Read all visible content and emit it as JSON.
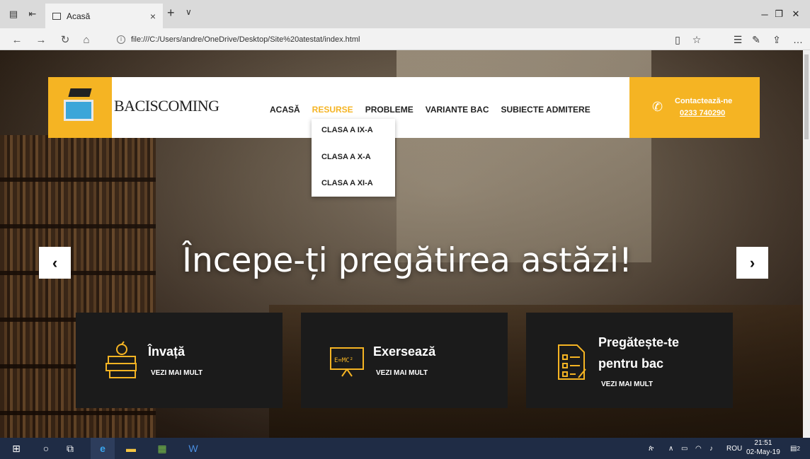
{
  "browser": {
    "tab_title": "Acasă",
    "tab_close": "×",
    "new_tab": "+",
    "tab_menu": "∨",
    "url": "file:///C:/Users/andre/OneDrive/Desktop/Site%20atestat/index.html",
    "minimize": "─",
    "restore": "❐",
    "close": "✕"
  },
  "header": {
    "brand": "BACISCOMING",
    "menu": [
      "ACASĂ",
      "RESURSE",
      "PROBLEME",
      "VARIANTE BAC",
      "SUBIECTE ADMITERE"
    ],
    "active_menu": "RESURSE",
    "contact_label": "Contactează-ne",
    "contact_phone": "0233 740290"
  },
  "dropdown": [
    "CLASA A IX-A",
    "CLASA A X-A",
    "CLASA A XI-A"
  ],
  "hero": {
    "title": "Începe-ți pregătirea astăzi!",
    "prev": "‹",
    "next": "›"
  },
  "features": [
    {
      "title": "Învață",
      "link": "VEZI MAI MULT",
      "icon": "books-apple-icon"
    },
    {
      "title": "Exersează",
      "link": "VEZI MAI MULT",
      "icon": "blackboard-icon"
    },
    {
      "title_line1": "Pregătește-te",
      "title_line2": "pentru bac",
      "link": "VEZI MAI MULT",
      "icon": "exam-paper-icon"
    }
  ],
  "taskbar": {
    "lang": "ROU",
    "time": "21:51",
    "date": "02-May-19",
    "notif_count": "2"
  },
  "colors": {
    "accent": "#f5b423",
    "feature_bg": "#1b1b1b",
    "taskbar": "#1f2c45"
  }
}
